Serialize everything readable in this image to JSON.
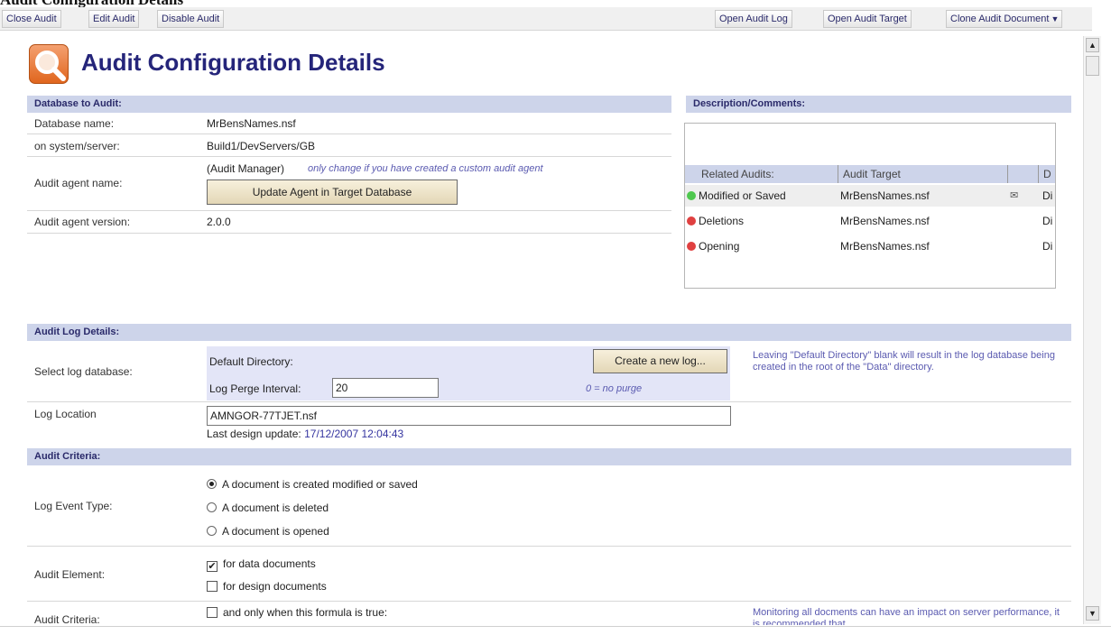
{
  "window": {
    "title": "Audit Configuration Details"
  },
  "toolbar": {
    "left": [
      "Close Audit",
      "Edit Audit",
      "Disable Audit"
    ],
    "right": [
      "Open Audit Log",
      "Open Audit Target",
      "Clone Audit Document"
    ]
  },
  "page": {
    "title": "Audit Configuration Details"
  },
  "database": {
    "header": "Database to Audit:",
    "name_label": "Database name:",
    "name_value": "MrBensNames.nsf",
    "server_label": "on system/server:",
    "server_value": "Build1/DevServers/GB",
    "agent_label": "Audit agent name:",
    "agent_value": "(Audit Manager)",
    "agent_note": "only change if you have created a custom audit agent",
    "update_button": "Update Agent in Target Database",
    "version_label": "Audit agent version:",
    "version_value": "2.0.0"
  },
  "description": {
    "header": "Description/Comments:",
    "related_columns": [
      "Related Audits:",
      "Audit Target",
      "",
      "D"
    ],
    "related": [
      {
        "name": "Modified or Saved",
        "target": "MrBensNames.nsf",
        "extra": "Di",
        "status_color": "#4fc84f",
        "mail": true
      },
      {
        "name": "Deletions",
        "target": "MrBensNames.nsf",
        "extra": "Di",
        "status_color": "#e04040",
        "mail": false
      },
      {
        "name": "Opening",
        "target": "MrBensNames.nsf",
        "extra": "Di",
        "status_color": "#e04040",
        "mail": false
      }
    ]
  },
  "log": {
    "header": "Audit Log Details:",
    "select_label": "Select log database:",
    "default_dir_label": "Default Directory:",
    "create_button": "Create a new log...",
    "purge_label": "Log Perge Interval:",
    "purge_value": "20",
    "purge_note": "0 = no purge",
    "hint": "Leaving \"Default Directory\" blank will result in the log database being created in the root of the \"Data\" directory.",
    "location_label": "Log Location",
    "location_value": "AMNGOR-77TJET.nsf",
    "last_update_label": "Last design update:",
    "last_update_value": "17/12/2007 12:04:43"
  },
  "criteria": {
    "header": "Audit Criteria:",
    "event_label": "Log Event Type:",
    "event_options": [
      "A document is created modified or saved",
      "A document is deleted",
      "A document is opened"
    ],
    "event_selected": 0,
    "element_label": "Audit Element:",
    "element_options": [
      "for data documents",
      "for design documents"
    ],
    "element_checked": [
      true,
      false
    ],
    "criteria_label": "Audit Criteria:",
    "formula_option": "and only when this formula is true:",
    "formula_note": "Monitoring all docments can have an impact on server performance, it is recommended that"
  }
}
